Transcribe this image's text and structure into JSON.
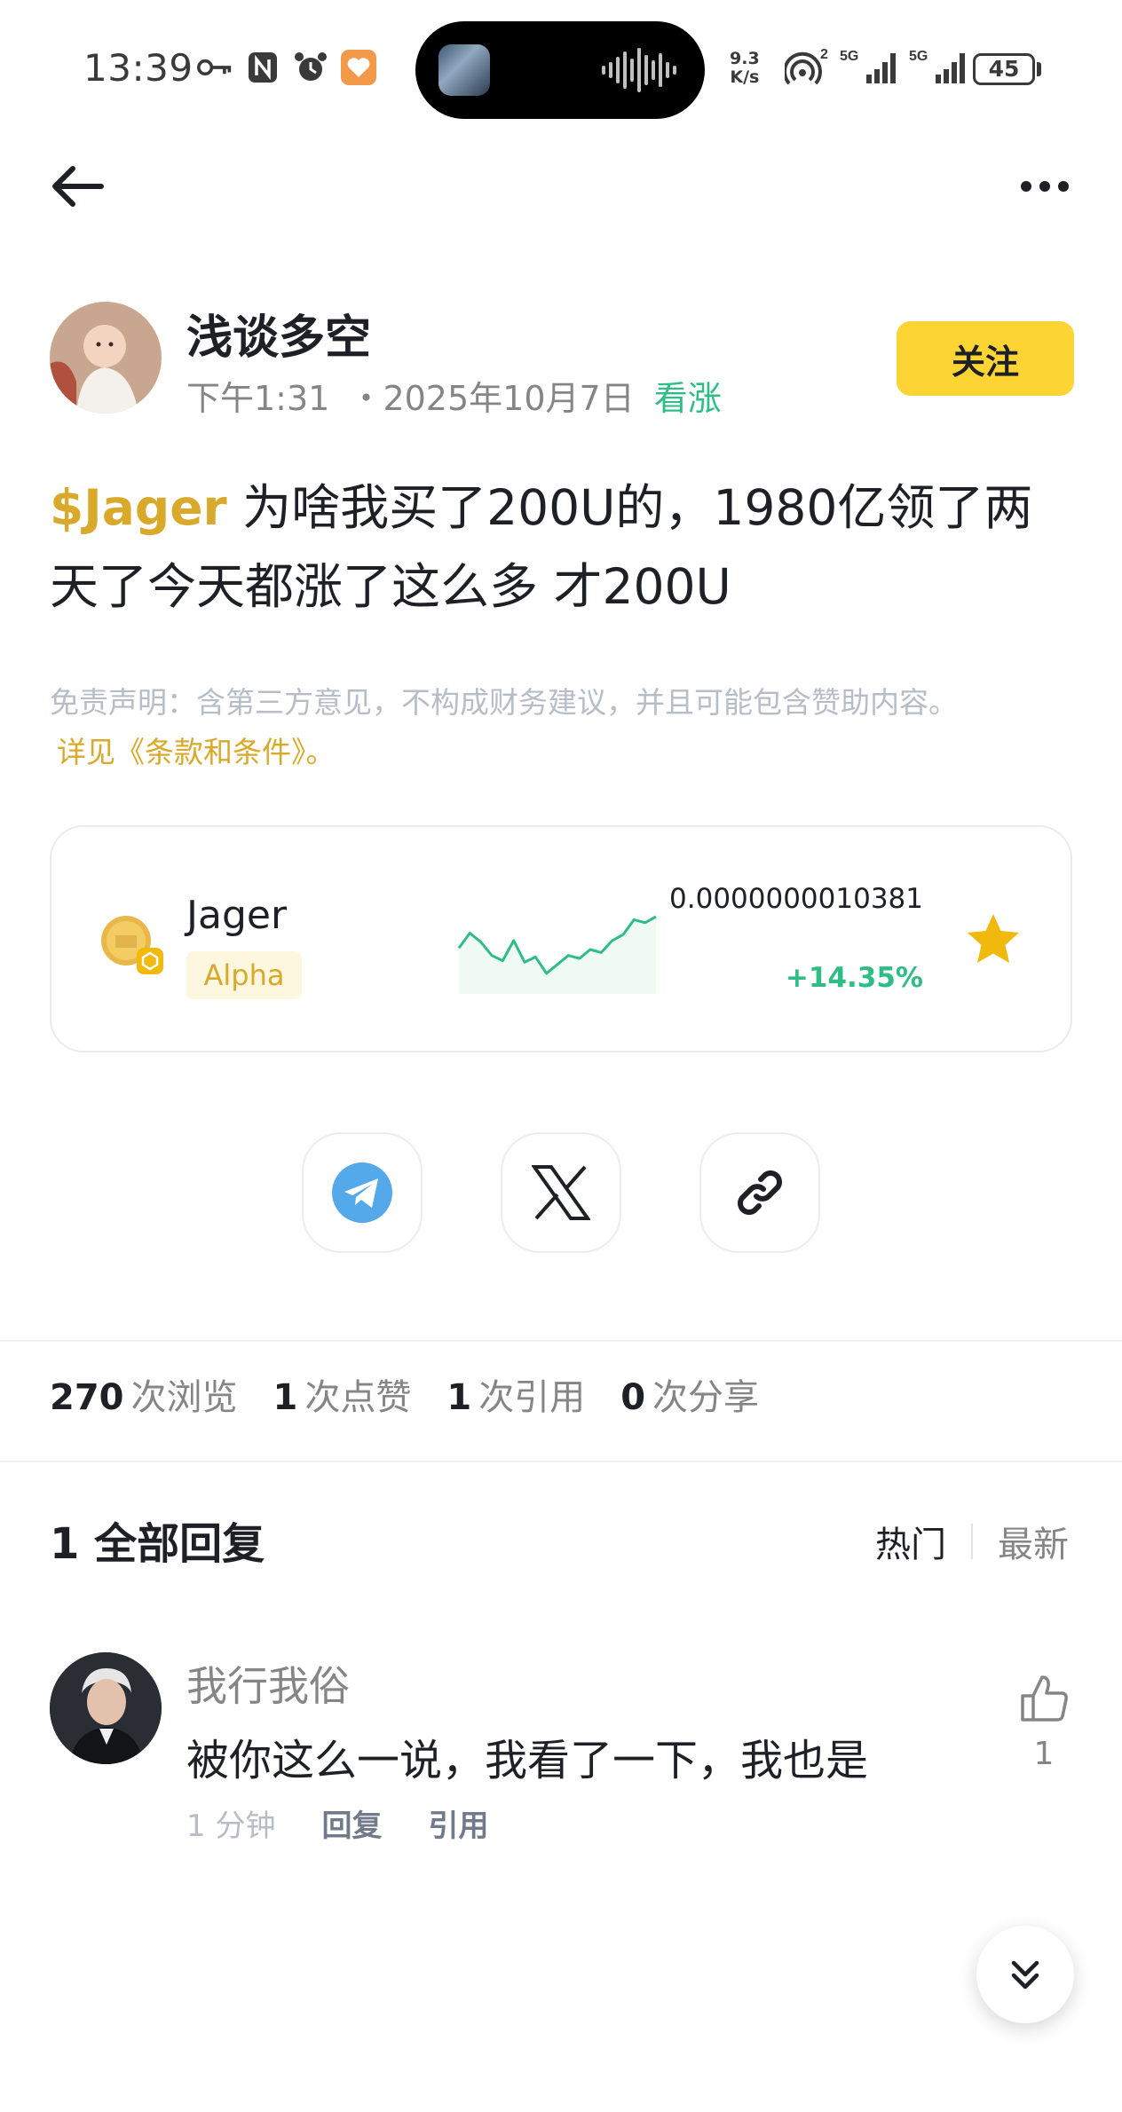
{
  "status_bar": {
    "time": "13:39",
    "net_speed_value": "9.3",
    "net_speed_unit": "K/s",
    "hotspot_badge": "2",
    "sim1_label": "5G",
    "sim2_label": "5G",
    "battery": "45"
  },
  "post": {
    "author": "浅谈多空",
    "time": "下午1:31",
    "date_prefix": "・",
    "date": "2025年10月7日",
    "sentiment": "看涨",
    "follow_label": "关注",
    "ticker": "$Jager",
    "body": " 为啥我买了200U的，1980亿领了两天了今天都涨了这么多  才200U",
    "disclaimer": "免责声明：含第三方意见，不构成财务建议，并且可能包含赞助内容。",
    "terms_link": "详见《条款和条件》。"
  },
  "token_card": {
    "name": "Jager",
    "badge": "Alpha",
    "price": "0.0000000010381",
    "change": "+14.35%",
    "sparkline": [
      0.52,
      0.72,
      0.6,
      0.42,
      0.35,
      0.62,
      0.33,
      0.4,
      0.18,
      0.3,
      0.42,
      0.38,
      0.5,
      0.46,
      0.62,
      0.7,
      0.9,
      0.86,
      0.94
    ],
    "colors": {
      "up": "#2ebd85",
      "accent": "#d8a92b",
      "star": "#f0b90b"
    }
  },
  "share": {
    "telegram_icon": "telegram-icon",
    "x_icon": "x-logo-icon",
    "link_icon": "link-icon"
  },
  "stats": {
    "views_count": "270",
    "views_label": "次浏览",
    "likes_count": "1",
    "likes_label": "次点赞",
    "quotes_count": "1",
    "quotes_label": "次引用",
    "shares_count": "0",
    "shares_label": "次分享"
  },
  "replies": {
    "title": "1 全部回复",
    "sort_hot": "热门",
    "sort_new": "最新",
    "items": [
      {
        "name": "我行我俗",
        "text": "被你这么一说，我看了一下，我也是",
        "time": "1 分钟",
        "reply_label": "回复",
        "quote_label": "引用",
        "likes": "1"
      }
    ]
  }
}
